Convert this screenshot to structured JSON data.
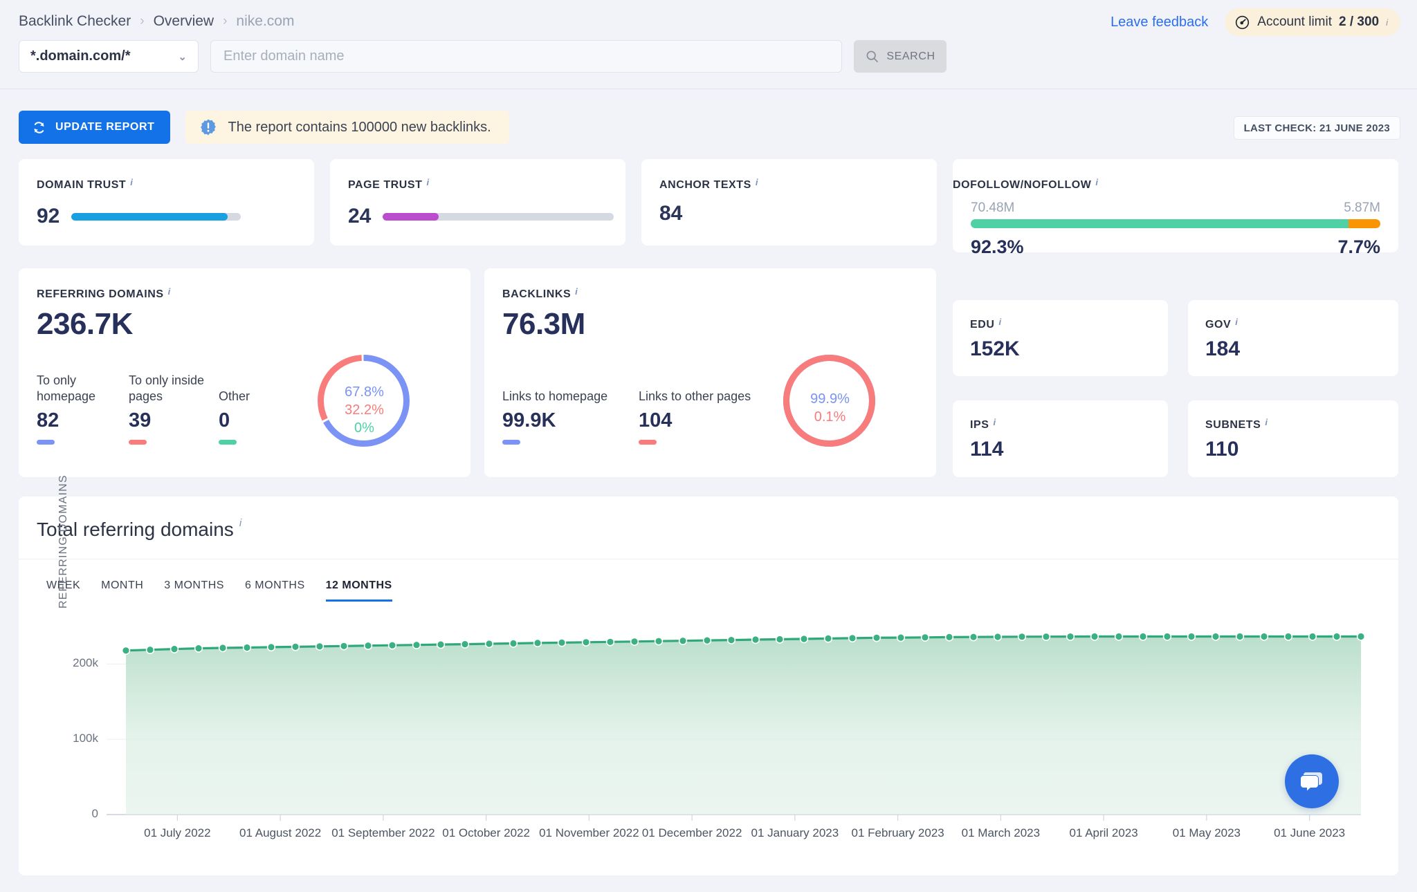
{
  "breadcrumb": {
    "items": [
      "Backlink Checker",
      "Overview",
      "nike.com"
    ],
    "separator": "›"
  },
  "header": {
    "feedback_label": "Leave feedback",
    "account_limit_label": "Account limit",
    "account_limit_value": "2 / 300",
    "gauge_icon": "gauge-icon",
    "info_glyph": "i"
  },
  "search": {
    "domain_mode": "*.domain.com/*",
    "chevron": "⌄",
    "placeholder": "Enter domain name",
    "value": "",
    "button_label": "SEARCH",
    "search_icon": "search-icon"
  },
  "actions": {
    "update_label": "UPDATE REPORT",
    "refresh_icon": "refresh-icon",
    "notice_icon": "warning-icon",
    "notice_text": "The report contains 100000 new backlinks.",
    "last_check": "LAST CHECK: 21 JUNE 2023"
  },
  "metrics": {
    "domain_trust": {
      "label": "DOMAIN TRUST",
      "value": "92",
      "percent": 92,
      "color": "#18a0e0"
    },
    "page_trust": {
      "label": "PAGE TRUST",
      "value": "24",
      "percent": 24,
      "color": "#bb4ccd"
    },
    "anchor_texts": {
      "label": "ANCHOR TEXTS",
      "value": "84"
    },
    "dofollow": {
      "label": "DOFOLLOW/NOFOLLOW",
      "left_count": "70.48M",
      "right_count": "5.87M",
      "left_percent": "92.3%",
      "right_percent": "7.7%",
      "left_share": 92.3,
      "left_color": "#4fd1a5",
      "right_color": "#f99405"
    }
  },
  "referring_domains": {
    "label": "REFERRING DOMAINS",
    "total": "236.7K",
    "stats": [
      {
        "name": "To only homepage",
        "value": "82",
        "color": "#7a93f5"
      },
      {
        "name": "To only inside pages",
        "value": "39",
        "color": "#f87c7c"
      },
      {
        "name": "Other",
        "value": "0",
        "color": "#4fd1a5"
      }
    ],
    "donut": {
      "slices": [
        {
          "label": "67.8%",
          "share": 67.8,
          "color": "#7a93f5"
        },
        {
          "label": "32.2%",
          "share": 32.2,
          "color": "#f87c7c"
        },
        {
          "label": "0%",
          "share": 0,
          "color": "#4fd1a5"
        }
      ]
    }
  },
  "backlinks": {
    "label": "BACKLINKS",
    "total": "76.3M",
    "stats": [
      {
        "name": "Links to homepage",
        "value": "99.9K",
        "color": "#7a93f5"
      },
      {
        "name": "Links to other pages",
        "value": "104",
        "color": "#f87c7c"
      }
    ],
    "donut": {
      "slices": [
        {
          "label": "99.9%",
          "share": 99.9,
          "color": "#7a93f5"
        },
        {
          "label": "0.1%",
          "share": 0.1,
          "color": "#f87c7c"
        }
      ]
    }
  },
  "mini_cards": [
    {
      "label": "EDU",
      "value": "152K"
    },
    {
      "label": "GOV",
      "value": "184"
    },
    {
      "label": "IPS",
      "value": "114"
    },
    {
      "label": "SUBNETS",
      "value": "110"
    }
  ],
  "chart_panel": {
    "title": "Total referring domains",
    "tabs": [
      {
        "label": "WEEK",
        "active": false
      },
      {
        "label": "MONTH",
        "active": false
      },
      {
        "label": "3 MONTHS",
        "active": false
      },
      {
        "label": "6 MONTHS",
        "active": false
      },
      {
        "label": "12 MONTHS",
        "active": true
      }
    ]
  },
  "chart_data": {
    "type": "area",
    "title": "Total referring domains",
    "xlabel": "",
    "ylabel": "REFERRING DOMAINS",
    "ylim": [
      0,
      250000
    ],
    "yticks": [
      0,
      100000,
      200000
    ],
    "ytick_labels": [
      "0",
      "100k",
      "200k"
    ],
    "grid": true,
    "legend": "none",
    "line_color": "#2fa87a",
    "marker_color": "#3bb183",
    "fill_color": "#cfe9dc",
    "xtick_labels": [
      "01 July 2022",
      "01 August 2022",
      "01 September 2022",
      "01 October 2022",
      "01 November 2022",
      "01 December 2022",
      "01 January 2023",
      "01 February 2023",
      "01 March 2023",
      "01 April 2023",
      "01 May 2023",
      "01 June 2023"
    ],
    "series": [
      {
        "name": "Referring domains",
        "values": [
          218000,
          219000,
          220000,
          221000,
          221500,
          222000,
          222500,
          223000,
          223500,
          224000,
          224500,
          225000,
          225500,
          226000,
          226500,
          227000,
          227500,
          228000,
          228500,
          229000,
          229500,
          230000,
          230500,
          231000,
          231500,
          232000,
          232500,
          233000,
          233500,
          234000,
          234500,
          235000,
          235200,
          235500,
          235800,
          236000,
          236200,
          236400,
          236500,
          236600,
          236650,
          236700,
          236700,
          236700,
          236700,
          236700,
          236700,
          236700,
          236700,
          236700,
          236700,
          236700
        ]
      }
    ]
  },
  "chat": {
    "icon": "chat-bubble-icon"
  }
}
